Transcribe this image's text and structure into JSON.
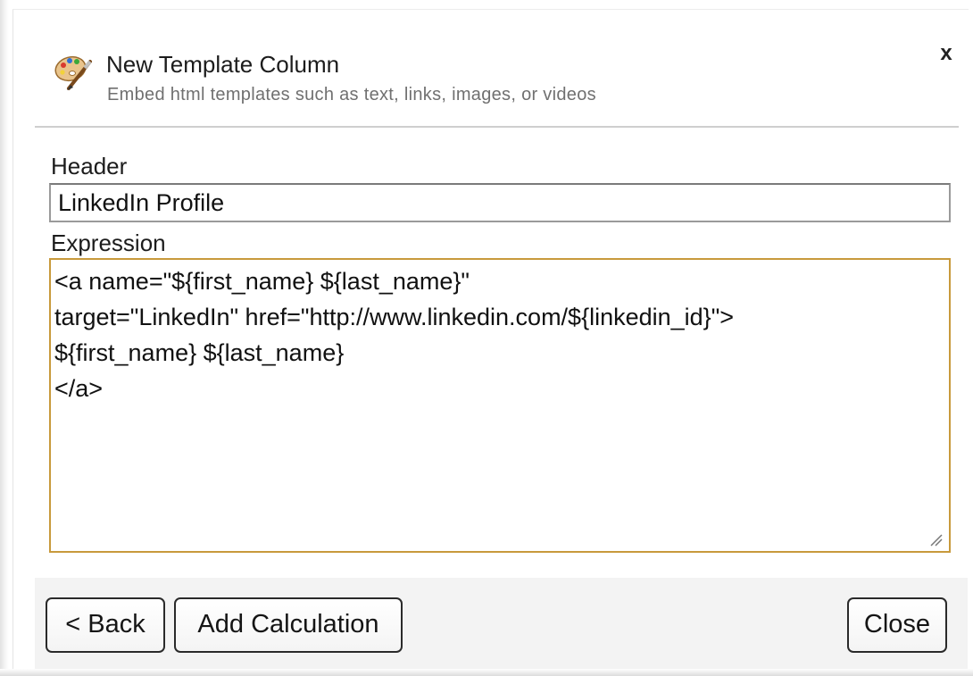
{
  "dialog": {
    "title": "New Template Column",
    "subtitle": "Embed html templates such as text, links, images, or videos",
    "close_label": "x",
    "icon": "palette-brush-icon"
  },
  "form": {
    "header_label": "Header",
    "header_value": "LinkedIn Profile",
    "expression_label": "Expression",
    "expression_value": "<a name=\"${first_name} ${last_name}\"\ntarget=\"LinkedIn\" href=\"http://www.linkedin.com/${linkedin_id}\">\n${first_name} ${last_name}\n</a>"
  },
  "footer": {
    "back_label": "< Back",
    "add_calculation_label": "Add Calculation",
    "close_label": "Close"
  },
  "colors": {
    "expression_focus_border": "#c89a3c",
    "footer_background": "#f3f3f3"
  }
}
